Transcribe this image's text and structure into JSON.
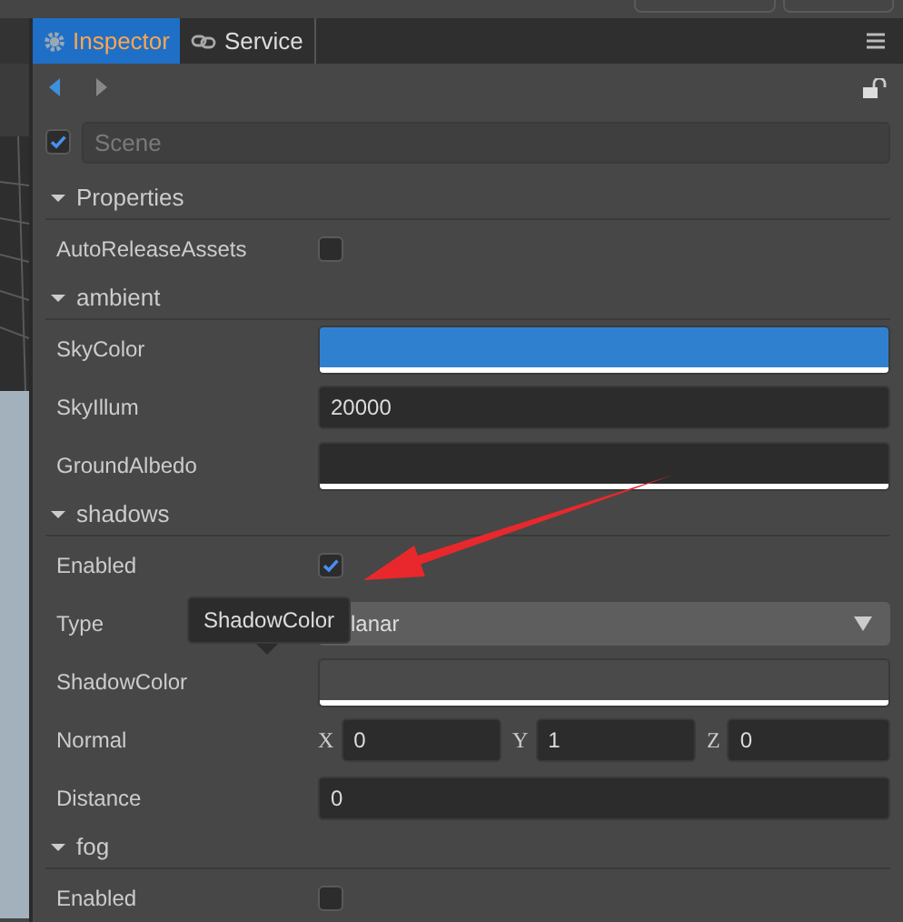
{
  "tabs": [
    {
      "label": "Inspector",
      "selected": true
    },
    {
      "label": "Service",
      "selected": false
    }
  ],
  "scene": {
    "enabled": true,
    "placeholder": "Scene"
  },
  "tooltip": {
    "text": "ShadowColor"
  },
  "sections": [
    {
      "title": "Properties",
      "expanded": true,
      "rows": [
        {
          "kind": "checkbox",
          "label": "AutoReleaseAssets",
          "checked": false
        }
      ]
    },
    {
      "title": "ambient",
      "expanded": true,
      "rows": [
        {
          "kind": "color",
          "label": "SkyColor",
          "color": "#3080d0"
        },
        {
          "kind": "number",
          "label": "SkyIllum",
          "value": "20000"
        },
        {
          "kind": "color",
          "label": "GroundAlbedo",
          "color": "#2c2c2c"
        }
      ]
    },
    {
      "title": "shadows",
      "expanded": true,
      "rows": [
        {
          "kind": "checkbox",
          "label": "Enabled",
          "checked": true
        },
        {
          "kind": "select",
          "label": "Type",
          "value": "lanar",
          "tooltip": true
        },
        {
          "kind": "color",
          "label": "ShadowColor",
          "color": "#4a4a4a"
        },
        {
          "kind": "vector",
          "label": "Normal",
          "components": [
            {
              "axis": "X",
              "value": "0"
            },
            {
              "axis": "Y",
              "value": "1"
            },
            {
              "axis": "Z",
              "value": "0"
            }
          ]
        },
        {
          "kind": "number",
          "label": "Distance",
          "value": "0"
        }
      ]
    },
    {
      "title": "fog",
      "expanded": true,
      "rows": [
        {
          "kind": "checkbox",
          "label": "Enabled",
          "checked": false
        }
      ]
    }
  ]
}
